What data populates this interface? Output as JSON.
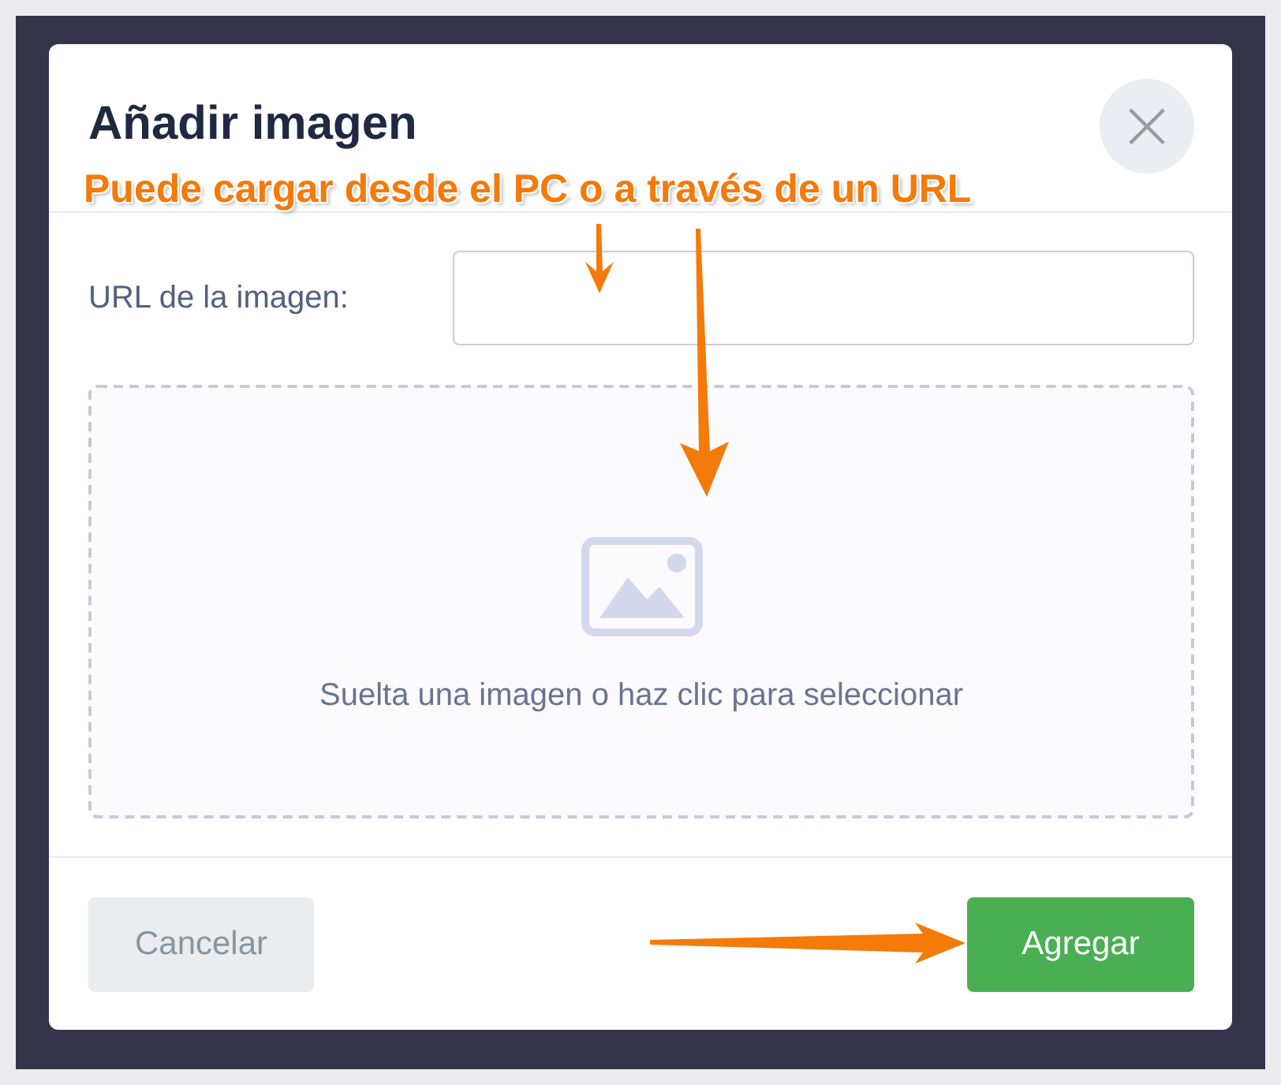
{
  "dialog": {
    "title": "Añadir imagen",
    "close_icon": "×"
  },
  "url_field": {
    "label": "URL de la imagen:"
  },
  "dropzone": {
    "text": "Suelta una imagen o haz clic para seleccionar"
  },
  "buttons": [
    {
      "label": "Cancelar",
      "kind": "secondary"
    },
    {
      "label": "Agregar",
      "kind": "primary"
    }
  ],
  "annotation": {
    "text": "Puede cargar desde el PC o a través de un URL"
  }
}
